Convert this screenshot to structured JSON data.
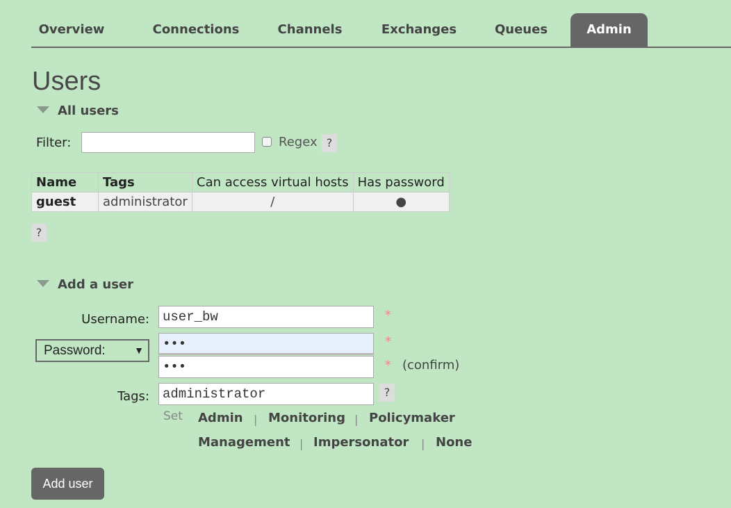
{
  "tabs": [
    {
      "label": "Overview"
    },
    {
      "label": "Connections"
    },
    {
      "label": "Channels"
    },
    {
      "label": "Exchanges"
    },
    {
      "label": "Queues"
    },
    {
      "label": "Admin",
      "active": true
    }
  ],
  "page_title": "Users",
  "all_users": {
    "heading": "All users",
    "filter_label": "Filter:",
    "filter_value": "",
    "regex_label": "Regex",
    "help": "?",
    "columns": [
      "Name",
      "Tags",
      "Can access virtual hosts",
      "Has password"
    ],
    "rows": [
      {
        "name": "guest",
        "tags": "administrator",
        "vhosts": "/",
        "has_password": "●"
      }
    ],
    "table_help": "?"
  },
  "add_user": {
    "heading": "Add a user",
    "username_label": "Username:",
    "username_value": "user_bw",
    "password_select": "Password:",
    "select_arrow": "▼",
    "password_value": "•••",
    "confirm_value": "•••",
    "confirm_label": "(confirm)",
    "required": "*",
    "tags_label": "Tags:",
    "tags_value": "administrator",
    "tags_help": "?",
    "set_label": "Set",
    "tag_options": [
      "Admin",
      "Monitoring",
      "Policymaker",
      "Management",
      "Impersonator",
      "None"
    ],
    "separator": "|",
    "submit_label": "Add user"
  },
  "colors": {
    "background": "#c0e6c4",
    "tab_active": "#666666",
    "button": "#666666",
    "required": "#ee8888"
  }
}
